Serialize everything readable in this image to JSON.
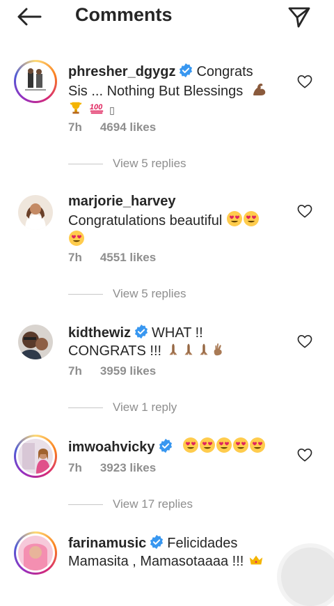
{
  "header": {
    "title": "Comments",
    "back_icon": "arrow-left-icon",
    "send_icon": "paper-plane-icon"
  },
  "comments": [
    {
      "username": "phresher_dgygz",
      "verified": true,
      "line1": "Congrats",
      "line2": "Sis ... Nothing But Blessings",
      "time": "7h",
      "likes": "4694 likes",
      "replies": "View 5 replies"
    },
    {
      "username": "marjorie_harvey",
      "verified": false,
      "line1": "Congratulations beautiful",
      "time": "7h",
      "likes": "4551 likes",
      "replies": "View 5 replies"
    },
    {
      "username": "kidthewiz",
      "verified": true,
      "line1": "WHAT !!",
      "line2": "CONGRATS !!!",
      "time": "7h",
      "likes": "3959 likes",
      "replies": "View 1 reply"
    },
    {
      "username": "imwoahvicky",
      "verified": true,
      "time": "7h",
      "likes": "3923 likes",
      "replies": "View 17 replies"
    },
    {
      "username": "farinamusic",
      "verified": true,
      "line1": "Felicidades",
      "line2": "Mamasita , Mamasotaaaa !!!"
    }
  ],
  "colors": {
    "verified": "#3897f0",
    "meta": "#8e8e8e",
    "text": "#262626"
  }
}
